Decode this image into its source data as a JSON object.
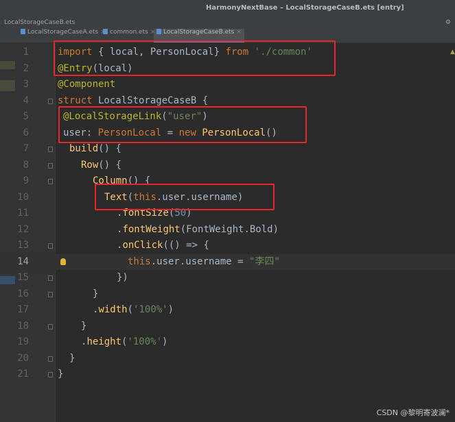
{
  "window": {
    "title": "HarmonyNextBase – LocalStorageCaseB.ets [entry]"
  },
  "navbar": {
    "file": "LocalStorageCaseB.ets"
  },
  "tabs": [
    {
      "label": "LocalStorageCaseA.ets",
      "close": "×",
      "icon_color": "#5b8fc9"
    },
    {
      "label": "common.ets",
      "close": "×",
      "icon_color": "#5b8fc9"
    },
    {
      "label": "LocalStorageCaseB.ets",
      "close": "×",
      "icon_color": "#5b8fc9",
      "active": true
    }
  ],
  "editor": {
    "current_line": 14,
    "lines": [
      {
        "n": "1",
        "tokens": [
          [
            "kw",
            "import"
          ],
          [
            "plain",
            " { local, PersonLocal} "
          ],
          [
            "kw",
            "from"
          ],
          [
            "plain",
            " "
          ],
          [
            "str",
            "'./common'"
          ]
        ]
      },
      {
        "n": "2",
        "tokens": [
          [
            "ann",
            "@Entry"
          ],
          [
            "plain",
            "(local)"
          ]
        ]
      },
      {
        "n": "3",
        "tokens": [
          [
            "ann",
            "@Component"
          ]
        ]
      },
      {
        "n": "4",
        "tokens": [
          [
            "kw",
            "struct"
          ],
          [
            "plain",
            " LocalStorageCaseB {"
          ]
        ]
      },
      {
        "n": "5",
        "tokens": [
          [
            "ann",
            "@LocalStorageLink"
          ],
          [
            "plain",
            "("
          ],
          [
            "str",
            "\"user\""
          ],
          [
            "plain",
            ")"
          ]
        ]
      },
      {
        "n": "6",
        "tokens": [
          [
            "plain",
            "user: "
          ],
          [
            "kw",
            "PersonLocal"
          ],
          [
            "plain",
            " = "
          ],
          [
            "kw",
            "new"
          ],
          [
            "plain",
            " "
          ],
          [
            "fn",
            "PersonLocal"
          ],
          [
            "plain",
            "()"
          ]
        ]
      },
      {
        "n": "7",
        "tokens": [
          [
            "fn",
            "build"
          ],
          [
            "plain",
            "() {"
          ]
        ]
      },
      {
        "n": "8",
        "tokens": [
          [
            "fn",
            "Row"
          ],
          [
            "plain",
            "() {"
          ]
        ]
      },
      {
        "n": "9",
        "tokens": [
          [
            "fn",
            "Column"
          ],
          [
            "plain",
            "() {"
          ]
        ]
      },
      {
        "n": "10",
        "tokens": [
          [
            "fn",
            "Text"
          ],
          [
            "plain",
            "("
          ],
          [
            "kw",
            "this"
          ],
          [
            "plain",
            ".user.username)"
          ]
        ]
      },
      {
        "n": "11",
        "tokens": [
          [
            "plain",
            "."
          ],
          [
            "fn",
            "fontSize"
          ],
          [
            "plain",
            "("
          ],
          [
            "num",
            "50"
          ],
          [
            "plain",
            ")"
          ]
        ]
      },
      {
        "n": "12",
        "tokens": [
          [
            "plain",
            "."
          ],
          [
            "fn",
            "fontWeight"
          ],
          [
            "plain",
            "(FontWeight.Bold)"
          ]
        ]
      },
      {
        "n": "13",
        "tokens": [
          [
            "plain",
            "."
          ],
          [
            "fn",
            "onClick"
          ],
          [
            "plain",
            "(() => {"
          ]
        ]
      },
      {
        "n": "14",
        "tokens": [
          [
            "kw",
            "this"
          ],
          [
            "plain",
            ".user.username = "
          ],
          [
            "str",
            "\"李四\""
          ]
        ]
      },
      {
        "n": "15",
        "tokens": [
          [
            "plain",
            "})"
          ]
        ]
      },
      {
        "n": "16",
        "tokens": [
          [
            "plain",
            "}"
          ]
        ]
      },
      {
        "n": "17",
        "tokens": [
          [
            "plain",
            "."
          ],
          [
            "fn",
            "width"
          ],
          [
            "plain",
            "("
          ],
          [
            "str",
            "'100%'"
          ],
          [
            "plain",
            ")"
          ]
        ]
      },
      {
        "n": "18",
        "tokens": [
          [
            "plain",
            "}"
          ]
        ]
      },
      {
        "n": "19",
        "tokens": [
          [
            "plain",
            "."
          ],
          [
            "fn",
            "height"
          ],
          [
            "plain",
            "("
          ],
          [
            "str",
            "'100%'"
          ],
          [
            "plain",
            ")"
          ]
        ]
      },
      {
        "n": "20",
        "tokens": [
          [
            "plain",
            "}"
          ]
        ]
      },
      {
        "n": "21",
        "tokens": [
          [
            "plain",
            "}"
          ]
        ]
      }
    ]
  },
  "watermark": "CSDN @黎明寄波澜*",
  "colors": {
    "keyword": "#cc7832",
    "function": "#ffc66d",
    "string": "#6a8759",
    "number": "#6897bb",
    "annotation": "#bbb529",
    "highlight_box": "#e8262b"
  }
}
